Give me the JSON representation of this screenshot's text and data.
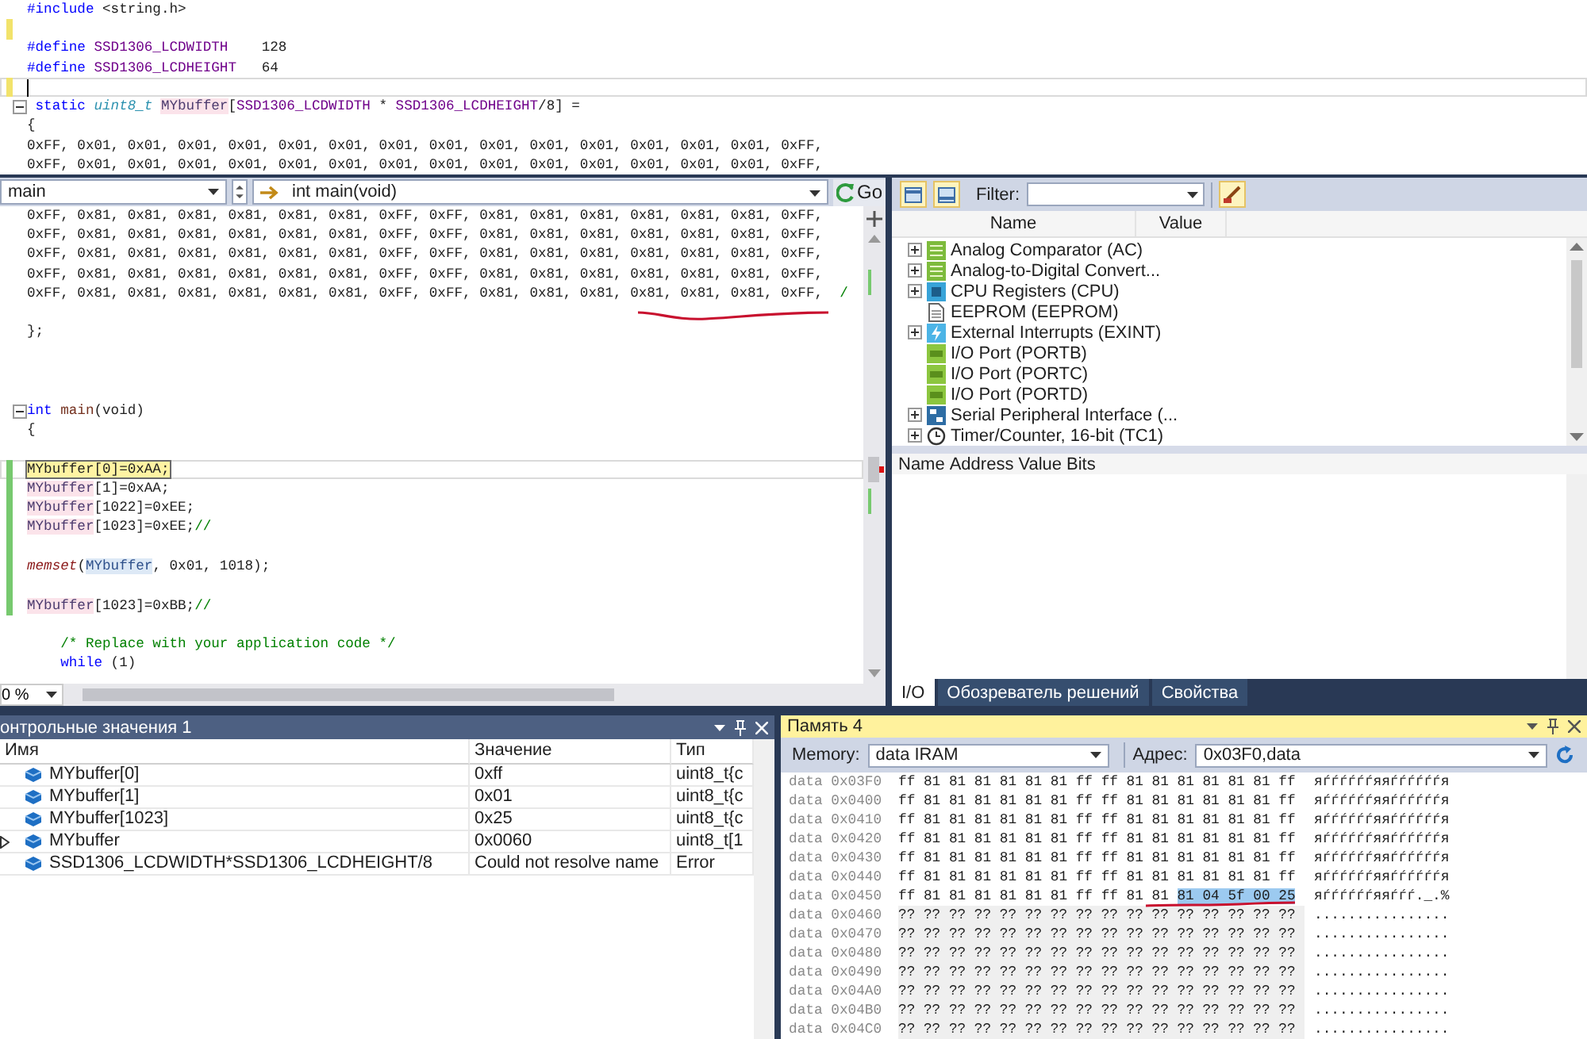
{
  "top_code": {
    "lines": [
      {
        "kind": "code",
        "segments": [
          {
            "kind": "kw",
            "text": "#include"
          },
          {
            "kind": "plain",
            "text": " <string.h>"
          }
        ]
      },
      {
        "kind": "blank",
        "color": "#f2e36b"
      },
      {
        "kind": "code",
        "segments": [
          {
            "kind": "kw",
            "text": "#define"
          },
          {
            "kind": "macro",
            "text": " SSD1306_LCDWIDTH"
          },
          {
            "kind": "plain",
            "text": "    128"
          }
        ]
      },
      {
        "kind": "code",
        "segments": [
          {
            "kind": "kw",
            "text": "#define"
          },
          {
            "kind": "macro",
            "text": " SSD1306_LCDHEIGHT"
          },
          {
            "kind": "plain",
            "text": "   64"
          }
        ]
      },
      {
        "kind": "cursor",
        "color": "#f2e36b"
      },
      {
        "kind": "fold",
        "segments": [
          {
            "kind": "kw",
            "text": " static "
          },
          {
            "kind": "type",
            "text": "uint8_t "
          },
          {
            "kind": "var",
            "text": "MYbuffer"
          },
          {
            "kind": "plain",
            "text": "["
          },
          {
            "kind": "macro",
            "text": "SSD1306_LCDWIDTH"
          },
          {
            "kind": "plain",
            "text": " * "
          },
          {
            "kind": "macro",
            "text": "SSD1306_LCDHEIGHT"
          },
          {
            "kind": "plain",
            "text": "/8] ="
          }
        ]
      },
      {
        "kind": "code",
        "segments": [
          {
            "kind": "plain",
            "text": "{"
          }
        ]
      },
      {
        "kind": "code",
        "segments": [
          {
            "kind": "plain",
            "text": "0xFF, 0x01, 0x01, 0x01, 0x01, 0x01, 0x01, 0x01, 0x01, 0x01, 0x01, 0x01, 0x01, 0x01, 0x01, 0xFF,"
          }
        ]
      },
      {
        "kind": "code",
        "segments": [
          {
            "kind": "plain",
            "text": "0xFF, 0x01, 0x01, 0x01, 0x01, 0x01, 0x01, 0x01, 0x01, 0x01, 0x01, 0x01, 0x01, 0x01, 0x01, 0xFF,"
          }
        ]
      }
    ]
  },
  "editor": {
    "scope_dropdown": "main",
    "function_dropdown": "int main(void)",
    "go_button": "Go",
    "zoom": "0 %",
    "lines": [
      {
        "kind": "code",
        "segments": [
          {
            "kind": "plain",
            "text": "0xFF, 0x81, 0x81, 0x81, 0x81, 0x81, 0x81, 0xFF, 0xFF, 0x81, 0x81, 0x81, 0x81, 0x81, 0x81, 0xFF,"
          }
        ]
      },
      {
        "kind": "code",
        "segments": [
          {
            "kind": "plain",
            "text": "0xFF, 0x81, 0x81, 0x81, 0x81, 0x81, 0x81, 0xFF, 0xFF, 0x81, 0x81, 0x81, 0x81, 0x81, 0x81, 0xFF,"
          }
        ]
      },
      {
        "kind": "code",
        "segments": [
          {
            "kind": "plain",
            "text": "0xFF, 0x81, 0x81, 0x81, 0x81, 0x81, 0x81, 0xFF, 0xFF, 0x81, 0x81, 0x81, 0x81, 0x81, 0x81, 0xFF,"
          }
        ]
      },
      {
        "kind": "code",
        "segments": [
          {
            "kind": "plain",
            "text": "0xFF, 0x81, 0x81, 0x81, 0x81, 0x81, 0x81, 0xFF, 0xFF, 0x81, 0x81, 0x81, 0x81, 0x81, 0x81, 0xFF,"
          }
        ]
      },
      {
        "kind": "code",
        "segments": [
          {
            "kind": "plain",
            "text": "0xFF, 0x81, 0x81, 0x81, 0x81, 0x81, 0x81, 0xFF, 0xFF, 0x81, 0x81, 0x81, 0x81, 0x81, 0x81, 0xFF,  "
          },
          {
            "kind": "comment",
            "text": "/"
          }
        ]
      },
      {
        "kind": "blank"
      },
      {
        "kind": "code",
        "segments": [
          {
            "kind": "plain",
            "text": "};"
          }
        ]
      },
      {
        "kind": "blank"
      },
      {
        "kind": "blank"
      },
      {
        "kind": "blank"
      },
      {
        "kind": "fold",
        "segments": [
          {
            "kind": "kw",
            "text": "int "
          },
          {
            "kind": "fn",
            "text": "main"
          },
          {
            "kind": "plain",
            "text": "(void)"
          }
        ]
      },
      {
        "kind": "code",
        "segments": [
          {
            "kind": "plain",
            "text": "{"
          }
        ]
      },
      {
        "kind": "blank"
      },
      {
        "kind": "current",
        "color": "#77c96f",
        "segments": [
          {
            "kind": "current",
            "text": "MYbuffer[0]=0xAA;"
          }
        ]
      },
      {
        "kind": "code",
        "color": "#77c96f",
        "segments": [
          {
            "kind": "var",
            "text": "MYbuffer"
          },
          {
            "kind": "plain",
            "text": "[1]=0xAA;"
          }
        ]
      },
      {
        "kind": "code",
        "color": "#77c96f",
        "segments": [
          {
            "kind": "var",
            "text": "MYbuffer"
          },
          {
            "kind": "plain",
            "text": "[1022]=0xEE;"
          }
        ]
      },
      {
        "kind": "code",
        "color": "#77c96f",
        "segments": [
          {
            "kind": "var",
            "text": "MYbuffer"
          },
          {
            "kind": "plain",
            "text": "[1023]=0xEE;"
          },
          {
            "kind": "comment",
            "text": "//"
          }
        ]
      },
      {
        "kind": "blank",
        "color": "#77c96f"
      },
      {
        "kind": "code",
        "color": "#77c96f",
        "segments": [
          {
            "kind": "fnit",
            "text": "memset"
          },
          {
            "kind": "plain",
            "text": "("
          },
          {
            "kind": "varref",
            "text": "MYbuffer"
          },
          {
            "kind": "plain",
            "text": ", 0x01, 1018);"
          }
        ]
      },
      {
        "kind": "blank",
        "color": "#77c96f"
      },
      {
        "kind": "code",
        "color": "#77c96f",
        "segments": [
          {
            "kind": "var",
            "text": "MYbuffer"
          },
          {
            "kind": "plain",
            "text": "[1023]=0xBB;"
          },
          {
            "kind": "comment",
            "text": "//"
          }
        ]
      },
      {
        "kind": "blank"
      },
      {
        "kind": "code",
        "segments": [
          {
            "kind": "comment",
            "text": "    /* Replace with your application code */"
          }
        ]
      },
      {
        "kind": "code",
        "segments": [
          {
            "kind": "kw",
            "text": "    while"
          },
          {
            "kind": "plain",
            "text": " (1)"
          }
        ]
      }
    ]
  },
  "io_view": {
    "filter_label": "Filter:",
    "columns": [
      "Name",
      "Value"
    ],
    "items": [
      {
        "kind": "adc",
        "label": "Analog Comparator (AC)",
        "expandable": true
      },
      {
        "kind": "adc",
        "label": "Analog-to-Digital Convert...",
        "expandable": true
      },
      {
        "kind": "cpu",
        "label": "CPU Registers (CPU)",
        "expandable": true
      },
      {
        "kind": "doc",
        "label": "EEPROM (EEPROM)",
        "expandable": false
      },
      {
        "kind": "interrupt",
        "label": "External Interrupts (EXINT)",
        "expandable": true
      },
      {
        "kind": "io",
        "label": "I/O Port (PORTB)",
        "expandable": false
      },
      {
        "kind": "io",
        "label": "I/O Port (PORTC)",
        "expandable": false
      },
      {
        "kind": "io",
        "label": "I/O Port (PORTD)",
        "expandable": false
      },
      {
        "kind": "spi",
        "label": "Serial Peripheral Interface (...",
        "expandable": true
      },
      {
        "kind": "clock",
        "label": "Timer/Counter, 16-bit (TC1)",
        "expandable": true
      }
    ],
    "register_columns": [
      "Name",
      "Address",
      "Value",
      "Bits"
    ],
    "tabs": [
      {
        "label": "I/O",
        "selected": true
      },
      {
        "label": "Обозреватель решений",
        "selected": false
      },
      {
        "label": "Свойства",
        "selected": false
      }
    ]
  },
  "watch": {
    "title": "онтрольные значения 1",
    "columns": [
      "Имя",
      "Значение",
      "Тип"
    ],
    "rows": [
      {
        "name": "MYbuffer[0]",
        "value": "0xff",
        "type": "uint8_t{c",
        "expandable": false
      },
      {
        "name": "MYbuffer[1]",
        "value": "0x01",
        "type": "uint8_t{c",
        "expandable": false
      },
      {
        "name": "MYbuffer[1023]",
        "value": "0x25",
        "type": "uint8_t{c",
        "expandable": false
      },
      {
        "name": "MYbuffer",
        "value": "0x0060",
        "type": "uint8_t[1",
        "expandable": true
      },
      {
        "name": "SSD1306_LCDWIDTH*SSD1306_LCDHEIGHT/8",
        "value": "Could not resolve name",
        "type": "Error",
        "expandable": false
      }
    ]
  },
  "memory": {
    "title": "Память 4",
    "memory_label": "Memory:",
    "memory_value": "data IRAM",
    "address_label": "Адрес:",
    "address_value": "0x03F0,data",
    "rows": [
      {
        "address": "data 0x03F0",
        "unreadable": false,
        "segments": [
          {
            "text": "ff 81 81 81 81 81 81 ff ff 81 81 81 81 81 81 ff",
            "selected": false
          }
        ],
        "ascii": "яѓѓѓѓѓѓяяѓѓѓѓѓѓя"
      },
      {
        "address": "data 0x0400",
        "unreadable": false,
        "segments": [
          {
            "text": "ff 81 81 81 81 81 81 ff ff 81 81 81 81 81 81 ff",
            "selected": false
          }
        ],
        "ascii": "яѓѓѓѓѓѓяяѓѓѓѓѓѓя"
      },
      {
        "address": "data 0x0410",
        "unreadable": false,
        "segments": [
          {
            "text": "ff 81 81 81 81 81 81 ff ff 81 81 81 81 81 81 ff",
            "selected": false
          }
        ],
        "ascii": "яѓѓѓѓѓѓяяѓѓѓѓѓѓя"
      },
      {
        "address": "data 0x0420",
        "unreadable": false,
        "segments": [
          {
            "text": "ff 81 81 81 81 81 81 ff ff 81 81 81 81 81 81 ff",
            "selected": false
          }
        ],
        "ascii": "яѓѓѓѓѓѓяяѓѓѓѓѓѓя"
      },
      {
        "address": "data 0x0430",
        "unreadable": false,
        "segments": [
          {
            "text": "ff 81 81 81 81 81 81 ff ff 81 81 81 81 81 81 ff",
            "selected": false
          }
        ],
        "ascii": "яѓѓѓѓѓѓяяѓѓѓѓѓѓя"
      },
      {
        "address": "data 0x0440",
        "unreadable": false,
        "segments": [
          {
            "text": "ff 81 81 81 81 81 81 ff ff 81 81 81 81 81 81 ff",
            "selected": false
          }
        ],
        "ascii": "яѓѓѓѓѓѓяяѓѓѓѓѓѓя"
      },
      {
        "address": "data 0x0450",
        "unreadable": false,
        "segments": [
          {
            "text": "ff 81 81 81 81 81 81 ff ff 81 81",
            "selected": false
          },
          {
            "text": "81 04 5f 00 25",
            "selected": true
          }
        ],
        "ascii": "яѓѓѓѓѓѓяяѓѓѓ._.%"
      },
      {
        "address": "data 0x0460",
        "unreadable": true,
        "segments": [
          {
            "text": "?? ?? ?? ?? ?? ?? ?? ?? ?? ?? ?? ?? ?? ?? ?? ??",
            "selected": false
          }
        ],
        "ascii": "................"
      },
      {
        "address": "data 0x0470",
        "unreadable": true,
        "segments": [
          {
            "text": "?? ?? ?? ?? ?? ?? ?? ?? ?? ?? ?? ?? ?? ?? ?? ??",
            "selected": false
          }
        ],
        "ascii": "................"
      },
      {
        "address": "data 0x0480",
        "unreadable": true,
        "segments": [
          {
            "text": "?? ?? ?? ?? ?? ?? ?? ?? ?? ?? ?? ?? ?? ?? ?? ??",
            "selected": false
          }
        ],
        "ascii": "................"
      },
      {
        "address": "data 0x0490",
        "unreadable": true,
        "segments": [
          {
            "text": "?? ?? ?? ?? ?? ?? ?? ?? ?? ?? ?? ?? ?? ?? ?? ??",
            "selected": false
          }
        ],
        "ascii": "................"
      },
      {
        "address": "data 0x04A0",
        "unreadable": true,
        "segments": [
          {
            "text": "?? ?? ?? ?? ?? ?? ?? ?? ?? ?? ?? ?? ?? ?? ?? ??",
            "selected": false
          }
        ],
        "ascii": "................"
      },
      {
        "address": "data 0x04B0",
        "unreadable": true,
        "segments": [
          {
            "text": "?? ?? ?? ?? ?? ?? ?? ?? ?? ?? ?? ?? ?? ?? ?? ??",
            "selected": false
          }
        ],
        "ascii": "................"
      },
      {
        "address": "data 0x04C0",
        "unreadable": true,
        "segments": [
          {
            "text": "?? ?? ?? ?? ?? ?? ?? ?? ?? ?? ?? ?? ?? ?? ?? ??",
            "selected": false
          }
        ],
        "ascii": "................"
      }
    ]
  }
}
